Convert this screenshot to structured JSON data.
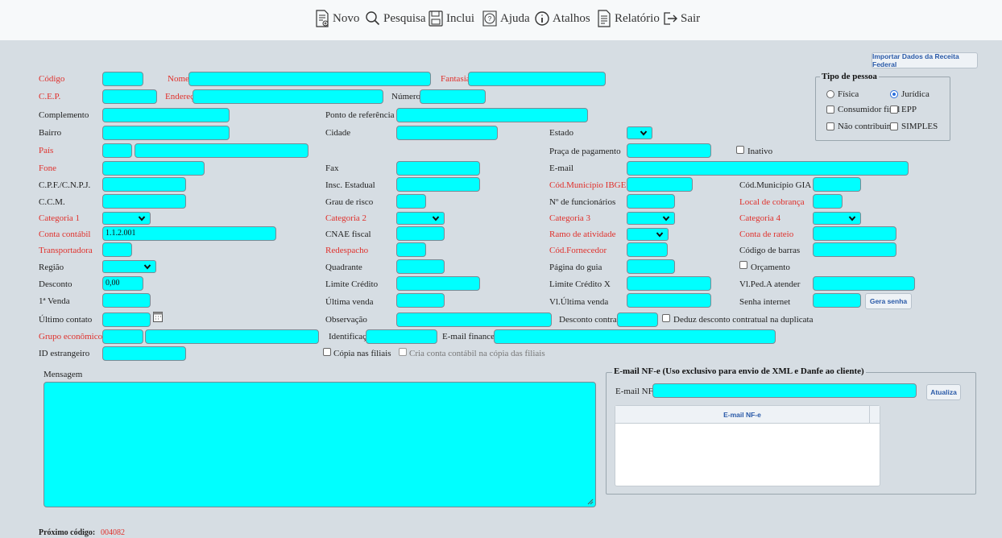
{
  "toolbar": {
    "novo": "Novo",
    "pesquisa": "Pesquisa",
    "inclui": "Inclui",
    "ajuda": "Ajuda",
    "atalhos": "Atalhos",
    "relatorio": "Relatório",
    "sair": "Sair"
  },
  "buttons": {
    "importar": "Importar Dados da Receita Federal",
    "gera_senha": "Gera senha",
    "atualiza": "Atualiza"
  },
  "tipo_pessoa": {
    "legend": "Tipo de pessoa",
    "fisica": "Física",
    "juridica": "Jurídica",
    "consumidor_final": "Consumidor final",
    "epp": "EPP",
    "nao_contribuinte": "Não contribuinte",
    "simples": "SIMPLES",
    "selected": "Jurídica"
  },
  "labels": {
    "codigo": "Código",
    "nome": "Nome",
    "fantasia": "Fantasia",
    "cep": "C.E.P.",
    "endereco": "Endereço",
    "numero": "Número",
    "complemento": "Complemento",
    "ponto_referencia": "Ponto de referência",
    "bairro": "Bairro",
    "cidade": "Cidade",
    "estado": "Estado",
    "pais": "País",
    "praca_pagamento": "Praça de pagamento",
    "inativo": "Inativo",
    "fone": "Fone",
    "fax": "Fax",
    "email": "E-mail",
    "cpf_cnpj": "C.P.F./C.N.P.J.",
    "insc_estadual": "Insc. Estadual",
    "cod_municipio_ibge": "Cód.Município IBGE",
    "cod_municipio_gia": "Cód.Município GIA",
    "ccm": "C.C.M.",
    "grau_risco": "Grau de risco",
    "n_funcionarios": "Nº de funcionários",
    "local_cobranca": "Local de cobrança",
    "categoria1": "Categoria 1",
    "categoria2": "Categoria 2",
    "categoria3": "Categoria 3",
    "categoria4": "Categoria 4",
    "conta_contabil": "Conta contábil",
    "cnae_fiscal": "CNAE fiscal",
    "ramo_atividade": "Ramo de atividade",
    "conta_rateio": "Conta de rateio",
    "transportadora": "Transportadora",
    "redespacho": "Redespacho",
    "cod_fornecedor": "Cód.Fornecedor",
    "codigo_barras": "Código de barras",
    "regiao": "Região",
    "quadrante": "Quadrante",
    "pagina_guia": "Página do guia",
    "orcamento": "Orçamento",
    "desconto": "Desconto",
    "limite_credito": "Limite Crédito",
    "limite_credito_x": "Limite Crédito X",
    "vl_ped_atender": "Vl.Ped.A atender",
    "primeira_venda": "1ª Venda",
    "ultima_venda": "Última venda",
    "vl_ultima_venda": "Vl.Última venda",
    "senha_internet": "Senha internet",
    "ultimo_contato": "Último contato",
    "observacao": "Observação",
    "desconto_contratual": "Desconto contratual",
    "deduz_desconto": "Deduz desconto contratual na duplicata",
    "grupo_economico": "Grupo econômico",
    "identificacao": "Identificação",
    "email_financeiro": "E-mail financeiro",
    "id_estrangeiro": "ID estrangeiro",
    "copia_filiais": "Cópia nas filiais",
    "cria_conta_contabil": "Cria conta contábil na cópia das filiais",
    "mensagem": "Mensagem"
  },
  "values": {
    "conta_contabil": "1.1.2.001",
    "desconto": "0,00"
  },
  "nfe": {
    "legend": "E-mail NF-e (Uso exclusivo para envio de XML e Danfe ao cliente)",
    "label": "E-mail NF-e",
    "column": "E-mail NF-e"
  },
  "footer": {
    "label": "Próximo código:",
    "value": "004082"
  },
  "colors": {
    "field": "#00ffff",
    "required_label": "#e0302b",
    "background": "#d6dde3"
  }
}
